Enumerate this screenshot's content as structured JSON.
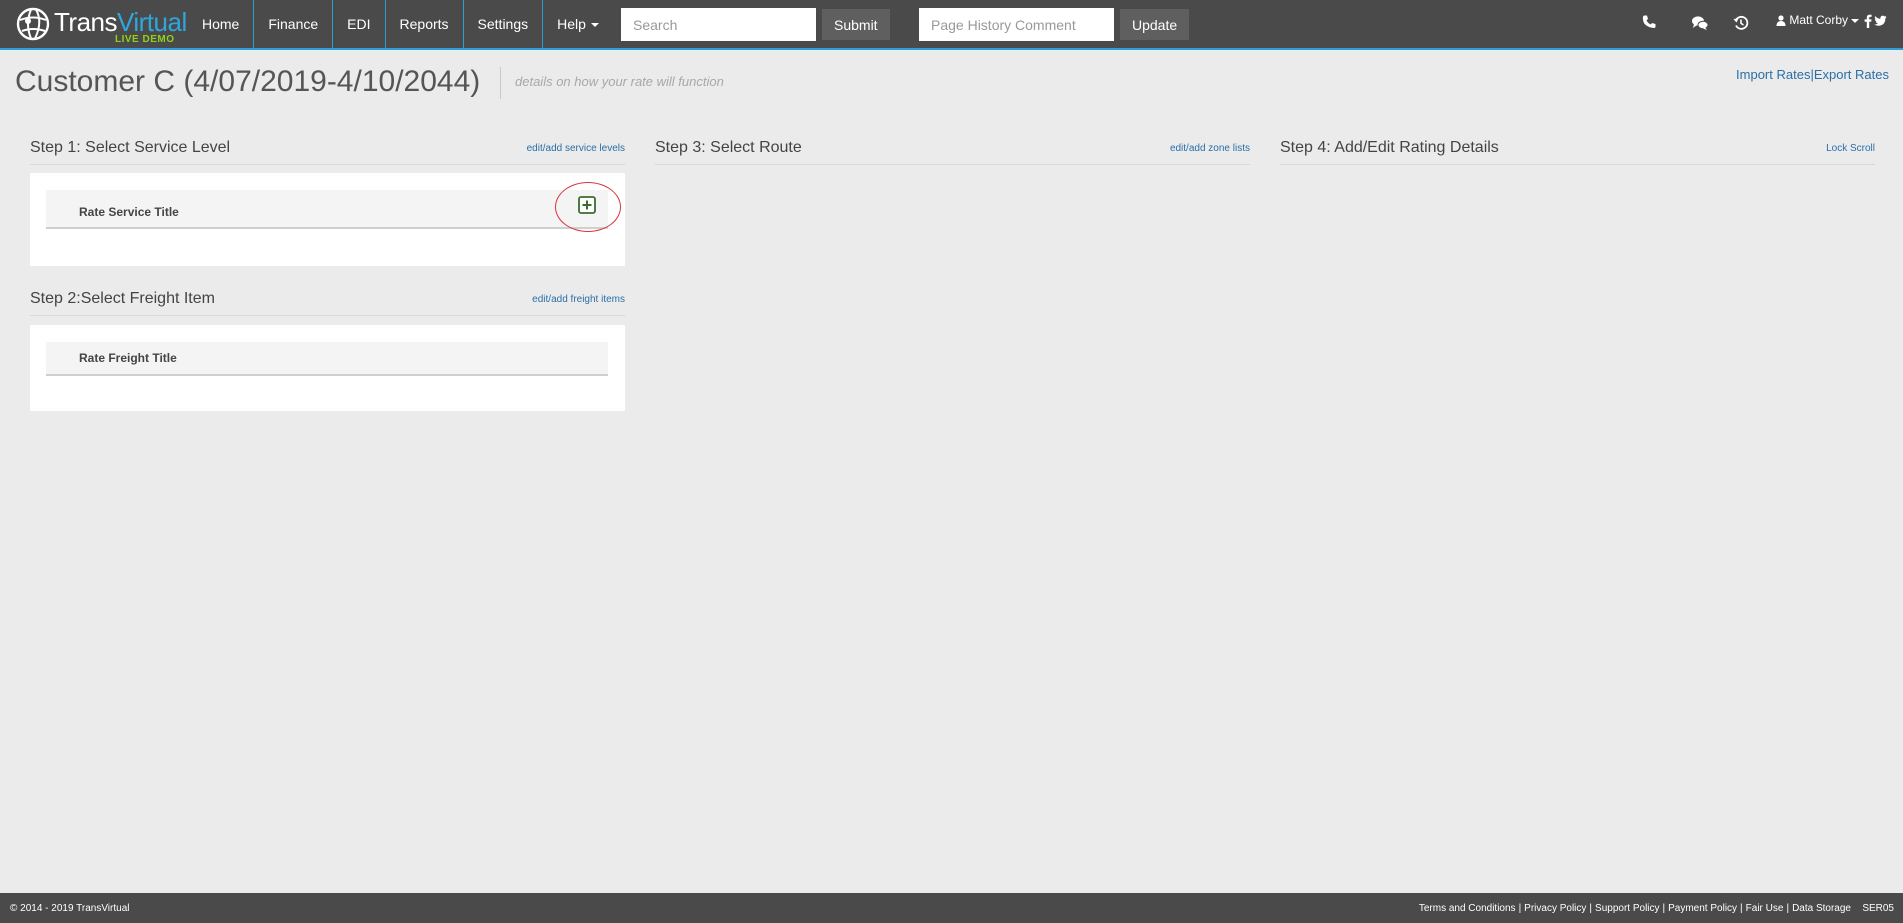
{
  "brand": {
    "name_part1": "Trans",
    "name_part2": "Virtual",
    "badge": "LIVE DEMO",
    "accent_color": "#2b9fd6",
    "badge_color": "#8fd11a"
  },
  "nav": {
    "items": [
      {
        "label": "Home"
      },
      {
        "label": "Finance"
      },
      {
        "label": "EDI"
      },
      {
        "label": "Reports"
      },
      {
        "label": "Settings"
      },
      {
        "label": "Help"
      }
    ],
    "search": {
      "placeholder": "Search",
      "button": "Submit"
    },
    "history": {
      "placeholder": "Page History Comment",
      "button": "Update"
    },
    "icons": [
      "phone-icon",
      "chat-icon",
      "history-icon"
    ],
    "user": {
      "name": "Matt Corby"
    },
    "social": [
      "facebook-icon",
      "twitter-icon"
    ]
  },
  "page": {
    "title": "Customer C (4/07/2019-4/10/2044)",
    "subtitle": "details on how your rate will function",
    "import_link": "Import Rates",
    "separator": "|",
    "export_link": "Export Rates"
  },
  "steps": {
    "step1": {
      "title": "Step 1: Select Service Level",
      "link": "edit/add service levels",
      "column": "Rate Service Title"
    },
    "step2": {
      "title": "Step 2:Select Freight Item",
      "link": "edit/add freight items",
      "column": "Rate Freight Title"
    },
    "step3": {
      "title": "Step 3: Select Route",
      "link": "edit/add zone lists"
    },
    "step4": {
      "title": "Step 4: Add/Edit Rating Details",
      "link": "Lock Scroll"
    }
  },
  "footer": {
    "copyright": "© 2014 - 2019 TransVirtual",
    "links": [
      "Terms and Conditions",
      "Privacy Policy",
      "Support Policy",
      "Payment Policy",
      "Fair Use",
      "Data Storage"
    ],
    "separator": "|",
    "server_code": "SER05"
  }
}
